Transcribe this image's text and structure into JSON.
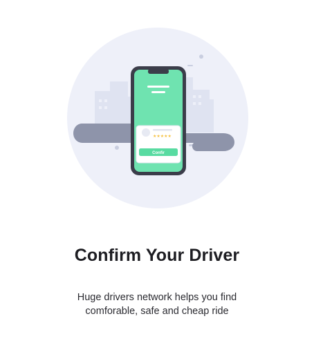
{
  "onboarding": {
    "title": "Confirm Your Driver",
    "description_line1": "Huge drivers network helps you find",
    "description_line2": "comforable, safe and cheap ride"
  },
  "illustration": {
    "card_button_label": "Confir",
    "rating_stars": "★★★★★",
    "colors": {
      "circle_bg": "#eef0f9",
      "buildings": "#dfe3f1",
      "road": "#8e94aa",
      "phone_frame": "#3b3d4a",
      "phone_screen": "#6fe3b0",
      "accent_green": "#58dba1",
      "card": "#ffffff",
      "star": "#f5c244"
    }
  }
}
